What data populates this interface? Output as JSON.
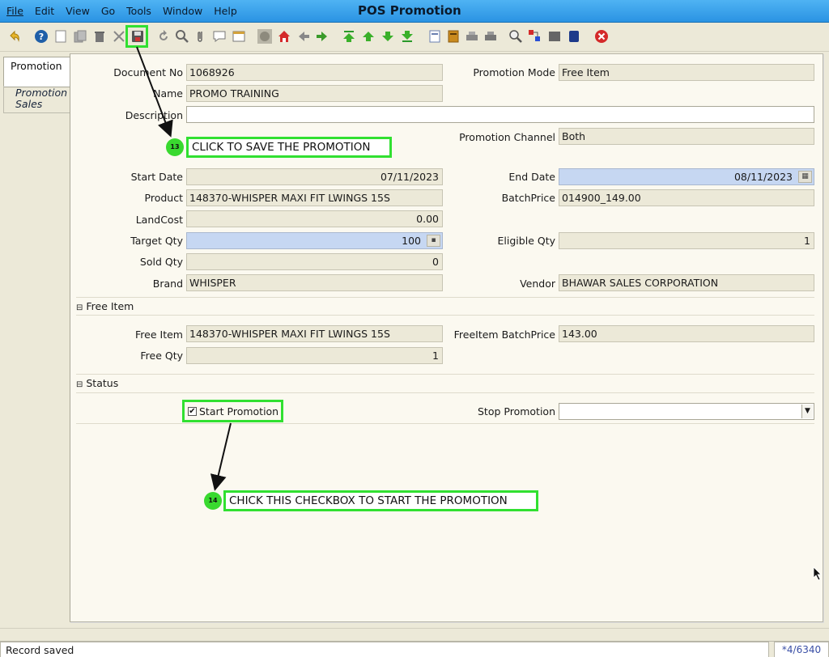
{
  "app": {
    "title": "POS Promotion"
  },
  "menu": {
    "file": "File",
    "edit": "Edit",
    "view": "View",
    "go": "Go",
    "tools": "Tools",
    "window": "Window",
    "help": "Help"
  },
  "tabs": {
    "promotion": "Promotion",
    "promotion_sales_line1": "Promotion",
    "promotion_sales_line2": "Sales"
  },
  "form": {
    "document_no": {
      "label": "Document No",
      "value": "1068926"
    },
    "name": {
      "label": "Name",
      "value": "PROMO TRAINING"
    },
    "description": {
      "label": "Description",
      "value": ""
    },
    "promotion_mode": {
      "label": "Promotion Mode",
      "value": "Free Item"
    },
    "promotion_channel": {
      "label": "Promotion Channel",
      "value": "Both"
    },
    "start_date": {
      "label": "Start Date",
      "value": "07/11/2023"
    },
    "end_date": {
      "label": "End Date",
      "value": "08/11/2023"
    },
    "product": {
      "label": "Product",
      "value": "148370-WHISPER MAXI FIT LWINGS 15S"
    },
    "batch_price": {
      "label": "BatchPrice",
      "value": "014900_149.00"
    },
    "land_cost": {
      "label": "LandCost",
      "value": "0.00"
    },
    "target_qty": {
      "label": "Target Qty",
      "value": "100"
    },
    "eligible_qty": {
      "label": "Eligible Qty",
      "value": "1"
    },
    "sold_qty": {
      "label": "Sold Qty",
      "value": "0"
    },
    "brand": {
      "label": "Brand",
      "value": "WHISPER"
    },
    "vendor": {
      "label": "Vendor",
      "value": "BHAWAR SALES CORPORATION"
    }
  },
  "free_item_section": {
    "title": "Free Item",
    "free_item": {
      "label": "Free Item",
      "value": "148370-WHISPER MAXI FIT LWINGS 15S"
    },
    "free_item_batch_price": {
      "label": "FreeItem BatchPrice",
      "value": "143.00"
    },
    "free_qty": {
      "label": "Free Qty",
      "value": "1"
    }
  },
  "status_section": {
    "title": "Status",
    "start_promotion": {
      "label": "Start Promotion",
      "checked": true
    },
    "stop_promotion": {
      "label": "Stop Promotion",
      "value": ""
    }
  },
  "annotations": {
    "step13": {
      "number": "13",
      "text": "CLICK TO SAVE THE PROMOTION"
    },
    "step14": {
      "number": "14",
      "text": "CHICK THIS CHECKBOX TO START THE PROMOTION"
    }
  },
  "statusbar": {
    "message": "Record saved",
    "record_counter": "*4/6340"
  },
  "colors": {
    "title_bar": "#2a93e3",
    "highlight": "#31e031",
    "mandatory_field": "#c6d7f2",
    "delete_icon": "#d42a2a"
  }
}
